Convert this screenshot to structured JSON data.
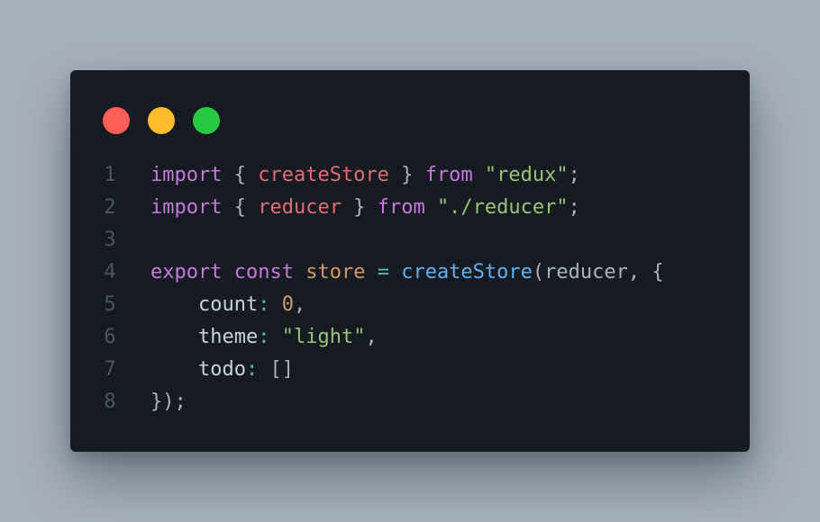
{
  "window_controls": {
    "close_color": "#ff5f57",
    "minimize_color": "#febc2e",
    "maximize_color": "#28c840"
  },
  "theme": {
    "keyword": "#c678dd",
    "import_name": "#e06c75",
    "string": "#98c379",
    "variable": "#d19a66",
    "operator": "#56b6c2",
    "function": "#61afef",
    "number": "#d19a66",
    "plain": "#c9d1d9",
    "punctuation": "#abb2bf",
    "line_number": "#4b5563"
  },
  "code": {
    "lines": [
      {
        "number": "1",
        "tokens": [
          {
            "text": "import",
            "kind": "keyword"
          },
          {
            "text": " { ",
            "kind": "punctuation"
          },
          {
            "text": "createStore",
            "kind": "import_name"
          },
          {
            "text": " } ",
            "kind": "punctuation"
          },
          {
            "text": "from",
            "kind": "keyword"
          },
          {
            "text": " ",
            "kind": "plain"
          },
          {
            "text": "\"redux\"",
            "kind": "string"
          },
          {
            "text": ";",
            "kind": "punctuation"
          }
        ]
      },
      {
        "number": "2",
        "tokens": [
          {
            "text": "import",
            "kind": "keyword"
          },
          {
            "text": " { ",
            "kind": "punctuation"
          },
          {
            "text": "reducer",
            "kind": "import_name"
          },
          {
            "text": " } ",
            "kind": "punctuation"
          },
          {
            "text": "from",
            "kind": "keyword"
          },
          {
            "text": " ",
            "kind": "plain"
          },
          {
            "text": "\"./reducer\"",
            "kind": "string"
          },
          {
            "text": ";",
            "kind": "punctuation"
          }
        ]
      },
      {
        "number": "3",
        "tokens": []
      },
      {
        "number": "4",
        "tokens": [
          {
            "text": "export",
            "kind": "keyword"
          },
          {
            "text": " ",
            "kind": "plain"
          },
          {
            "text": "const",
            "kind": "keyword"
          },
          {
            "text": " ",
            "kind": "plain"
          },
          {
            "text": "store",
            "kind": "variable"
          },
          {
            "text": " ",
            "kind": "plain"
          },
          {
            "text": "=",
            "kind": "operator"
          },
          {
            "text": " ",
            "kind": "plain"
          },
          {
            "text": "createStore",
            "kind": "function"
          },
          {
            "text": "(reducer, {",
            "kind": "punctuation"
          }
        ]
      },
      {
        "number": "5",
        "tokens": [
          {
            "text": "    count",
            "kind": "plain"
          },
          {
            "text": ":",
            "kind": "operator"
          },
          {
            "text": " ",
            "kind": "plain"
          },
          {
            "text": "0",
            "kind": "number"
          },
          {
            "text": ",",
            "kind": "punctuation"
          }
        ]
      },
      {
        "number": "6",
        "tokens": [
          {
            "text": "    theme",
            "kind": "plain"
          },
          {
            "text": ":",
            "kind": "operator"
          },
          {
            "text": " ",
            "kind": "plain"
          },
          {
            "text": "\"light\"",
            "kind": "string"
          },
          {
            "text": ",",
            "kind": "punctuation"
          }
        ]
      },
      {
        "number": "7",
        "tokens": [
          {
            "text": "    todo",
            "kind": "plain"
          },
          {
            "text": ":",
            "kind": "operator"
          },
          {
            "text": " ",
            "kind": "plain"
          },
          {
            "text": "[]",
            "kind": "punctuation"
          }
        ]
      },
      {
        "number": "8",
        "tokens": [
          {
            "text": "});",
            "kind": "punctuation"
          }
        ]
      }
    ]
  }
}
